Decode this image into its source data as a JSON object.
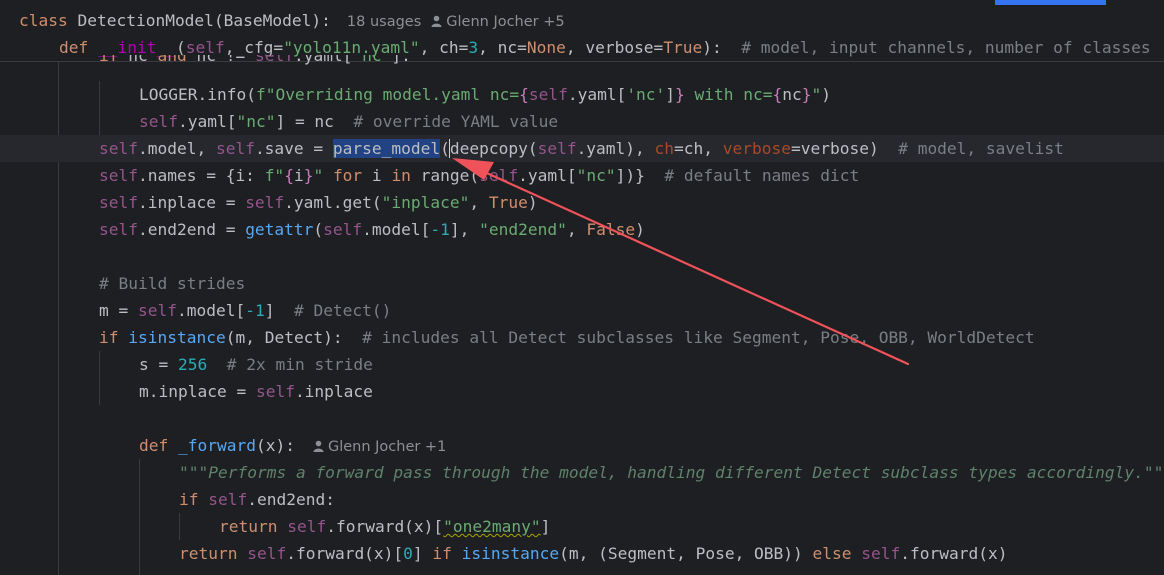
{
  "code": {
    "class_kw": "class",
    "class_name": "DetectionModel",
    "class_base": "(BaseModel):",
    "class_usages": "18 usages",
    "class_authors": "Glenn Jocher +5",
    "init_def": "def",
    "init_name": "__init__",
    "init_paren": "(",
    "init_self": "self",
    "init_args_a": ", cfg=",
    "init_cfg": "\"yolo11n.yaml\"",
    "init_args_b": ", ch=",
    "init_ch": "3",
    "init_args_c": ", nc=",
    "init_none": "None",
    "init_args_d": ", verbose=",
    "init_true": "True",
    "init_args_e": "):  ",
    "init_comment": "# model, input channels, number of classes",
    "l3_if": "if",
    "l3_a": " nc ",
    "l3_and": "and",
    "l3_b": " nc != ",
    "l3_self": "self",
    "l3_c": ".yaml[",
    "l3_str": "\"nc\"",
    "l3_d": "]:",
    "l4_a": "LOGGER.info(",
    "l4_str1": "f\"Overriding model.yaml nc=",
    "l4_brace1": "{",
    "l4_self": "self",
    "l4_b": ".yaml[",
    "l4_str2": "'nc'",
    "l4_c": "]",
    "l4_brace2": "}",
    "l4_str3": " with nc=",
    "l4_brace3": "{",
    "l4_d": "nc",
    "l4_brace4": "}",
    "l4_str4": "\"",
    "l4_e": ")",
    "l5_self": "self",
    "l5_a": ".yaml[",
    "l5_str": "\"nc\"",
    "l5_b": "] = nc  ",
    "l5_cmt": "# override YAML value",
    "l6_self1": "self",
    "l6_a": ".model, ",
    "l6_self2": "self",
    "l6_b": ".save = ",
    "l6_fn": "parse_model",
    "l6_c": "(deepcopy(",
    "l6_self3": "self",
    "l6_d": ".yaml), ",
    "l6_ch": "ch",
    "l6_e": "=ch, ",
    "l6_verbose": "verbose",
    "l6_f": "=verbose)  ",
    "l6_cmt": "# model, savelist",
    "l7_self1": "self",
    "l7_a": ".names = {i: ",
    "l7_str1": "f\"",
    "l7_b1": "{",
    "l7_i": "i",
    "l7_b2": "}",
    "l7_str2": "\"",
    "l7_sp": " ",
    "l7_for": "for",
    "l7_c": " i ",
    "l7_in": "in",
    "l7_d": " range(",
    "l7_self2": "self",
    "l7_e": ".yaml[",
    "l7_str3": "\"nc\"",
    "l7_f": "])}  ",
    "l7_cmt": "# default names dict",
    "l8_self1": "self",
    "l8_a": ".inplace = ",
    "l8_self2": "self",
    "l8_b": ".yaml.get(",
    "l8_str": "\"inplace\"",
    "l8_c": ", ",
    "l8_true": "True",
    "l8_d": ")",
    "l9_self1": "self",
    "l9_a": ".end2end = ",
    "l9_fn": "getattr",
    "l9_b": "(",
    "l9_self2": "self",
    "l9_c": ".model[",
    "l9_num": "-1",
    "l9_d": "], ",
    "l9_str": "\"end2end\"",
    "l9_e": ", ",
    "l9_false": "False",
    "l9_f": ")",
    "l11_cmt": "# Build strides",
    "l12_a": "m = ",
    "l12_self": "self",
    "l12_b": ".model[",
    "l12_num": "-1",
    "l12_c": "]  ",
    "l12_cmt": "# Detect()",
    "l13_if": "if",
    "l13_sp": " ",
    "l13_fn": "isinstance",
    "l13_a": "(m, Detect):  ",
    "l13_cmt": "# includes all Detect subclasses like Segment, Pose, OBB, WorldDetect",
    "l14_a": "s = ",
    "l14_num": "256",
    "l14_b": "  ",
    "l14_cmt": "# 2x min stride",
    "l15_a": "m.inplace = ",
    "l15_self": "self",
    "l15_b": ".inplace",
    "l17_def": "def",
    "l17_sp": " ",
    "l17_fn": "_forward",
    "l17_a": "(x):",
    "l17_author": "Glenn Jocher +1",
    "l18_doc": "\"\"\"Performs a forward pass through the model, handling different Detect subclass types accordingly.\"\"\"",
    "l19_if": "if",
    "l19_sp": " ",
    "l19_self": "self",
    "l19_a": ".end2end:",
    "l20_ret": "return",
    "l20_sp": " ",
    "l20_self": "self",
    "l20_a": ".forward(x)[",
    "l20_str": "\"one2many\"",
    "l20_b": "]",
    "l21_ret": "return",
    "l21_sp": " ",
    "l21_self1": "self",
    "l21_a": ".forward(x)[",
    "l21_num": "0",
    "l21_b": "] ",
    "l21_if": "if",
    "l21_sp2": " ",
    "l21_fn": "isinstance",
    "l21_c": "(m, (Segment, Pose, OBB)) ",
    "l21_else": "else",
    "l21_sp3": " ",
    "l21_self2": "self",
    "l21_d": ".forward(x)"
  },
  "icons": {
    "author_icon": "person-icon",
    "annotation_arrow": "arrow-annotation"
  },
  "colors": {
    "background": "#1e1f22",
    "keyword": "#cf8e6d",
    "self": "#94558d",
    "string": "#6aab73",
    "number": "#2aacb8",
    "comment": "#7a7e85",
    "function": "#56a8f5",
    "selection": "#214283",
    "arrow": "#f0525a"
  }
}
